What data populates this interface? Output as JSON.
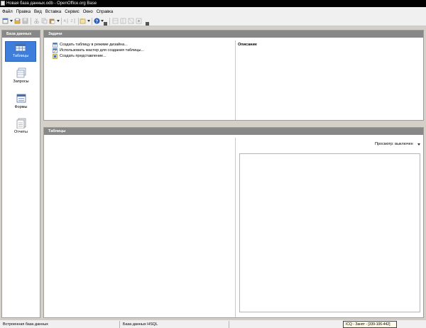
{
  "window": {
    "title": "Новая база данных.odb - OpenOffice.org Base"
  },
  "menubar": {
    "items": [
      "Файл",
      "Правка",
      "Вид",
      "Вставка",
      "Сервис",
      "Окно",
      "Справка"
    ]
  },
  "toolbar": {
    "buttons": [
      "new-icon",
      "open-icon",
      "save-icon",
      "cut-icon",
      "copy-icon",
      "paste-icon",
      "sort-icon",
      "help-icon",
      "view-icon",
      "view2-icon",
      "view3-icon",
      "view4-icon"
    ]
  },
  "left_panel": {
    "header": "База данных",
    "categories": [
      {
        "label": "Таблицы",
        "icon": "tables-icon",
        "selected": true
      },
      {
        "label": "Запросы",
        "icon": "queries-icon",
        "selected": false
      },
      {
        "label": "Формы",
        "icon": "forms-icon",
        "selected": false
      },
      {
        "label": "Отчеты",
        "icon": "reports-icon",
        "selected": false
      }
    ]
  },
  "tasks": {
    "header": "Задачи",
    "items": [
      {
        "label": "Создать таблицу в режиме дизайна...",
        "icon": "design-table-icon"
      },
      {
        "label": "Использовать мастер для создания таблицы...",
        "icon": "wizard-icon"
      },
      {
        "label": "Создать представление...",
        "icon": "create-view-icon"
      }
    ],
    "description_label": "Описание"
  },
  "tables": {
    "header": "Таблицы",
    "preview_label": "Просмотр: выключен"
  },
  "statusbar": {
    "left": "Встроенная база данных",
    "middle": "База данных HSQL"
  },
  "tooltip": {
    "text": "ICQ - Занят - [339-106-442]"
  },
  "colors": {
    "selected_category": "#3d7ddb",
    "panel_header": "#888888",
    "workspace": "#d4d0c8"
  }
}
